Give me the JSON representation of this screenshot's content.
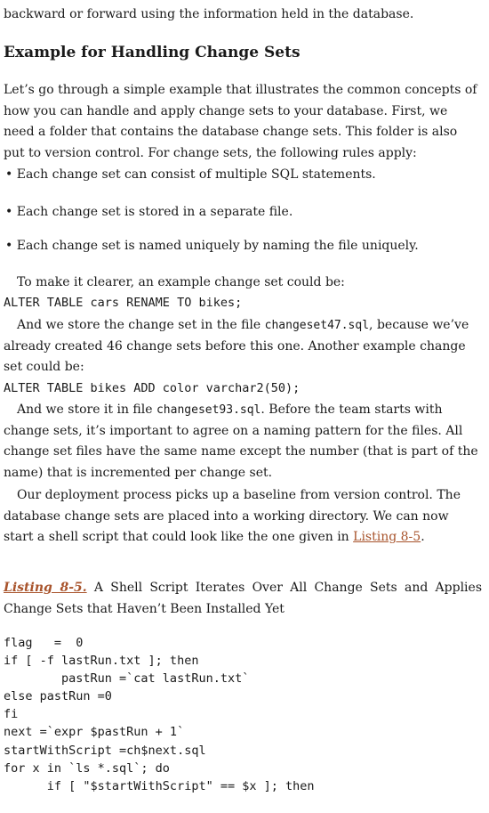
{
  "intro_line": "backward or forward using the information held in the database.",
  "heading": "Example for Handling Change Sets",
  "para1": "Let’s go through a simple example that illustrates the common concepts of how you can handle and apply change sets to your database. First, we need a folder that contains the database change sets. This folder is also put to version control. For change sets, the following rules apply:",
  "bullets": [
    "Each change set can consist of multiple SQL statements.",
    "Each change set is stored in a separate file.",
    "Each change set is named uniquely by naming the file uniquely."
  ],
  "para2": "To make it clearer, an example change set could be:",
  "code1": "ALTER TABLE cars RENAME TO bikes;",
  "para3_pre": "And we store the change set in the file ",
  "para3_file": "changeset47.sql",
  "para3_post": ", because we’ve already created 46 change sets before this one. Another example change set could be:",
  "code2": "ALTER TABLE bikes ADD color varchar2(50);",
  "para4_pre": "And we store it in file ",
  "para4_file": "changeset93.sql",
  "para4_post": ". Before the team starts with change sets, it’s important to agree on a naming pattern for the files. All change set files have the same name except the number (that is part of the name) that is incremented per change set.",
  "para5_pre": "Our deployment process picks up a baseline from version control. The database change sets are placed into a working directory. We can now start a shell script that could look like the one given in ",
  "para5_link": "Listing 8-5",
  "para5_post": ".",
  "caption_label": "Listing 8-5.",
  "caption_text": " A Shell Script Iterates Over All Change Sets and Applies Change Sets that Haven’t Been Installed Yet",
  "listing": "flag   =  0\nif [ -f lastRun.txt ]; then\n        pastRun =`cat lastRun.txt`\nelse pastRun =0\nfi\nnext =`expr $pastRun + 1`\nstartWithScript =ch$next.sql\nfor x in `ls *.sql`; do\n      if [ \"$startWithScript\" == $x ]; then"
}
